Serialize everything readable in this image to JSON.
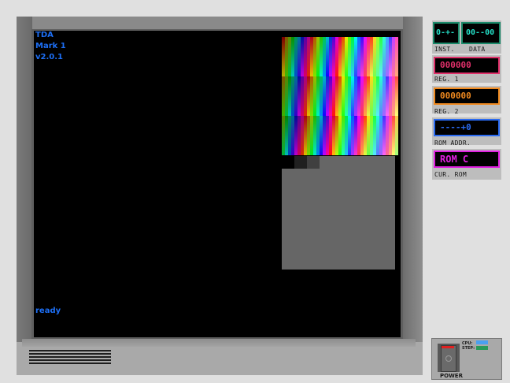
{
  "screen": {
    "brand": "TDA",
    "model": "Mark 1",
    "version": "v2.0.1",
    "status": "ready"
  },
  "registers": {
    "inst": {
      "value": "0-+-",
      "label": "INST."
    },
    "data": {
      "value": "00--00",
      "label": "DATA"
    },
    "reg1": {
      "value": "000000",
      "label": "REG. 1",
      "color": "#e0306a"
    },
    "reg2": {
      "value": "000000",
      "label": "REG. 2",
      "color": "#f08a20"
    },
    "rom_addr": {
      "value": "----+0",
      "label": "ROM ADDR.",
      "color": "#2a6af0"
    },
    "cur_rom": {
      "value": "ROM C",
      "label": "CUR.  ROM",
      "color": "#e020e0"
    }
  },
  "power": {
    "label": "POWER",
    "cpu_label": "CPU:",
    "step_label": "STEP:"
  },
  "colors": {
    "screen_text": "#1d6ff5",
    "inst_text": "#24e0c8"
  }
}
